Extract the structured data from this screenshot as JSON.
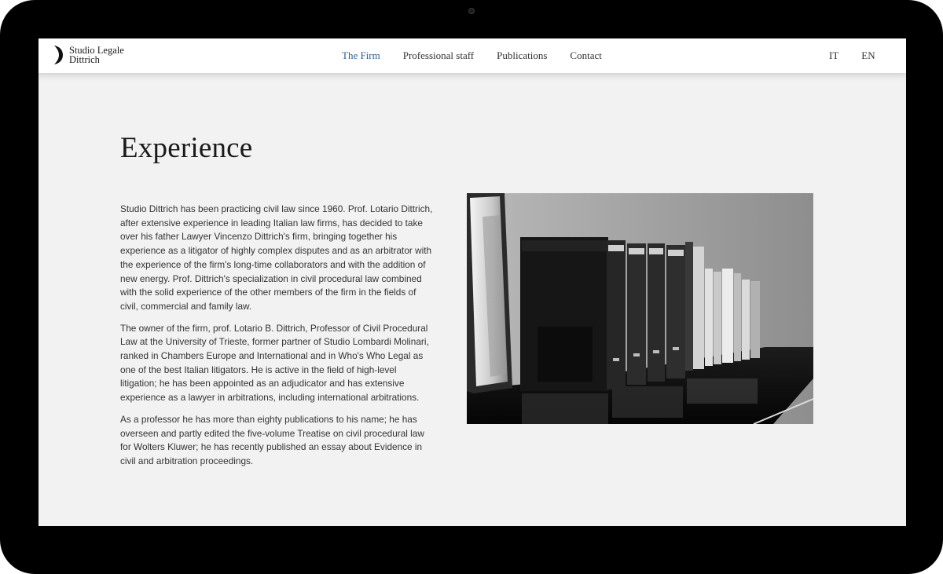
{
  "site": {
    "logo_line1": "Studio Legale",
    "logo_line2": "Dittrich"
  },
  "nav": {
    "items": [
      {
        "label": "The Firm",
        "active": true
      },
      {
        "label": "Professional staff",
        "active": false
      },
      {
        "label": "Publications",
        "active": false
      },
      {
        "label": "Contact",
        "active": false
      }
    ],
    "active_color": "#2f5f8f"
  },
  "languages": [
    "IT",
    "EN"
  ],
  "page": {
    "title": "Experience",
    "paragraphs": [
      "Studio Dittrich has been practicing civil law since 1960. Prof. Lotario Dittrich, after extensive experience in leading Italian law firms, has decided to take over his father Lawyer Vincenzo Dittrich's firm, bringing together his experience as a litigator of highly complex disputes and as an arbitrator with the experience of the firm's long-time collaborators and with the addition of new energy. Prof. Dittrich's specialization in civil procedural law combined with the solid experience of the other members of the firm in the fields of civil, commercial and family law.",
      "The owner of the firm, prof. Lotario B. Dittrich, Professor of Civil Procedural Law at the University of Trieste, former partner of Studio Lombardi Molinari, ranked in Chambers Europe and International and in Who's Who Legal as one of the best Italian litigators. He is active in the field of high-level litigation; he has been appointed as an adjudicator and has extensive experience as a lawyer in arbitrations, including international arbitrations.",
      "As a professor he has more than eighty publications to his name; he has overseen and partly edited the five-volume Treatise on civil procedural law for Wolters Kluwer; he has recently published an essay about Evidence in civil and arbitration proceedings."
    ]
  },
  "image": {
    "subject": "black-and-white photo of law books on a shelf"
  }
}
